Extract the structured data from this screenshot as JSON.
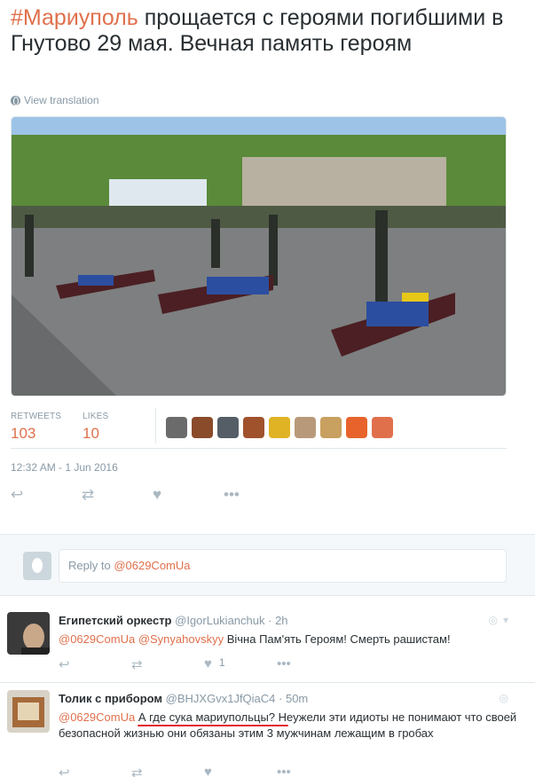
{
  "tweet": {
    "hashtag": "#Мариуполь",
    "text": " прощается с героями погибшими в Гнутово 29 мая. Вечная память героям",
    "translate_label": "View translation",
    "stats": {
      "retweets_label": "RETWEETS",
      "retweets": "103",
      "likes_label": "LIKES",
      "likes": "10"
    },
    "timestamp": "12:32 AM - 1 Jun 2016",
    "liker_avatar_colors": [
      "#6b6b6b",
      "#8a4b2b",
      "#555e66",
      "#a0522d",
      "#e0b324",
      "#b89a7a",
      "#c8a060",
      "#e8632b",
      "#e0704c"
    ]
  },
  "icons": {
    "reply": "reply-icon",
    "retweet": "retweet-icon",
    "like": "heart-icon",
    "more": "more-icon",
    "globe": "globe-icon",
    "location": "location-pin-icon"
  },
  "reply_box": {
    "prefix": "Reply to ",
    "mention": "@0629ComUa"
  },
  "replies": [
    {
      "name": "Египетский оркестр",
      "handle": "@IgorLukianchuk",
      "time": "· 2h",
      "mentions": [
        "@0629ComUa",
        "@Synyahovskyy"
      ],
      "text": " Вічна Пам'ять Героям! Смерть рашистам!",
      "likes": "1"
    },
    {
      "name": "Толик с прибором",
      "handle": "@BHJXGvx1JfQiaC4",
      "time": "· 50m",
      "mention": "@0629ComUa",
      "text_underlined": "А где сука мариупольцы?",
      "text_rest": " Неужели эти идиоты не понимают что своей безопасной жизнью они обязаны этим 3 мужчинам лежащим в гробах"
    }
  ],
  "accent_color": "#e0704c"
}
